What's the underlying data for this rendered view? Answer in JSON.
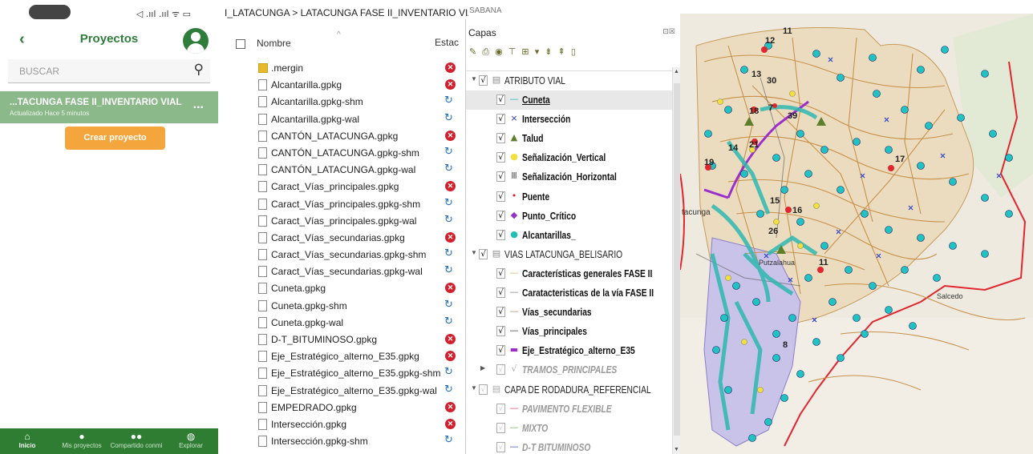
{
  "phone": {
    "status_icons": "◁ .ııl .ııl ᯤ ▭",
    "header": {
      "title": "Proyectos",
      "back_glyph": "‹"
    },
    "search": {
      "placeholder": "BUSCAR",
      "icon_glyph": "⚲"
    },
    "project": {
      "name": "...TACUNGA FASE II_INVENTARIO VIAL",
      "updated": "Actualizado Hace 5 minutos",
      "menu_glyph": "..."
    },
    "create_button": "Crear proyecto",
    "nav": [
      {
        "label": "Inicio",
        "icon": "home-icon",
        "glyph": "⌂"
      },
      {
        "label": "Mis proyectos",
        "icon": "person-icon",
        "glyph": "●"
      },
      {
        "label": "Compartido conmi",
        "icon": "people-icon",
        "glyph": "●●"
      },
      {
        "label": "Explorar",
        "icon": "globe-icon",
        "glyph": "◍"
      }
    ]
  },
  "files": {
    "breadcrumb": "I_LATACUNGA  >  LATACUNGA FASE II_INVENTARIO VIAL",
    "col_name": "Nombre",
    "col_status": "Estac",
    "items": [
      {
        "name": ".mergin",
        "type": "folder",
        "status": "error"
      },
      {
        "name": "Alcantarilla.gpkg",
        "type": "file",
        "status": "error"
      },
      {
        "name": "Alcantarilla.gpkg-shm",
        "type": "file",
        "status": "sync"
      },
      {
        "name": "Alcantarilla.gpkg-wal",
        "type": "file",
        "status": "sync"
      },
      {
        "name": "CANTÓN_LATACUNGA.gpkg",
        "type": "file",
        "status": "error"
      },
      {
        "name": "CANTÓN_LATACUNGA.gpkg-shm",
        "type": "file",
        "status": "sync"
      },
      {
        "name": "CANTÓN_LATACUNGA.gpkg-wal",
        "type": "file",
        "status": "sync"
      },
      {
        "name": "Caract_Vías_principales.gpkg",
        "type": "file",
        "status": "error"
      },
      {
        "name": "Caract_Vías_principales.gpkg-shm",
        "type": "file",
        "status": "sync"
      },
      {
        "name": "Caract_Vías_principales.gpkg-wal",
        "type": "file",
        "status": "sync"
      },
      {
        "name": "Caract_Vías_secundarias.gpkg",
        "type": "file",
        "status": "error"
      },
      {
        "name": "Caract_Vías_secundarias.gpkg-shm",
        "type": "file",
        "status": "sync"
      },
      {
        "name": "Caract_Vías_secundarias.gpkg-wal",
        "type": "file",
        "status": "sync"
      },
      {
        "name": "Cuneta.gpkg",
        "type": "file",
        "status": "error"
      },
      {
        "name": "Cuneta.gpkg-shm",
        "type": "file",
        "status": "sync"
      },
      {
        "name": "Cuneta.gpkg-wal",
        "type": "file",
        "status": "sync"
      },
      {
        "name": "D-T_BITUMINOSO.gpkg",
        "type": "file",
        "status": "error"
      },
      {
        "name": "Eje_Estratégico_alterno_E35.gpkg",
        "type": "file",
        "status": "error"
      },
      {
        "name": "Eje_Estratégico_alterno_E35.gpkg-shm",
        "type": "file",
        "status": "sync"
      },
      {
        "name": "Eje_Estratégico_alterno_E35.gpkg-wal",
        "type": "file",
        "status": "sync"
      },
      {
        "name": "EMPEDRADO.gpkg",
        "type": "file",
        "status": "error"
      },
      {
        "name": "Intersección.gpkg",
        "type": "file",
        "status": "error"
      },
      {
        "name": "Intersección.gpkg-shm",
        "type": "file",
        "status": "sync"
      }
    ],
    "status_glyphs": {
      "error": "✕",
      "sync": "↻"
    },
    "colors": {
      "error": "#d3202e",
      "sync": "#1e6fd0"
    }
  },
  "layers": {
    "title": "Capas",
    "panel_buttons": "⊡☒",
    "toolbar_glyphs": "✎ ⎙ ◉ ⊤ ⊞ ▾ ⇟ ⇞ ▯",
    "corner_text": "SABANA",
    "rows": [
      {
        "label": "ATRIBUTO VIAL",
        "level": 0,
        "kind": "group",
        "checked": true,
        "expanded": true,
        "symbol": "▤",
        "color": "#888"
      },
      {
        "label": "Cuneta",
        "level": 1,
        "kind": "layer",
        "checked": true,
        "symbol": "—",
        "color": "#1fbfb8",
        "selected": true,
        "underline": true
      },
      {
        "label": "Intersección",
        "level": 1,
        "kind": "layer",
        "checked": true,
        "symbol": "×",
        "color": "#2a3fc9"
      },
      {
        "label": "Talud",
        "level": 1,
        "kind": "layer",
        "checked": true,
        "symbol": "▲",
        "color": "#5b7f2a"
      },
      {
        "label": "Señalización_Vertical",
        "level": 1,
        "kind": "layer",
        "checked": true,
        "symbol": "●",
        "color": "#f1e13a"
      },
      {
        "label": "Señalización_Horizontal",
        "level": 1,
        "kind": "layer",
        "checked": true,
        "symbol": "Ⅲ",
        "color": "#555"
      },
      {
        "label": "Puente",
        "level": 1,
        "kind": "layer",
        "checked": true,
        "symbol": "•",
        "color": "#d3202e"
      },
      {
        "label": "Punto_Crítico",
        "level": 1,
        "kind": "layer",
        "checked": true,
        "symbol": "◆",
        "color": "#9b2fc9"
      },
      {
        "label": "Alcantarillas_",
        "level": 1,
        "kind": "layer",
        "checked": true,
        "symbol": "●",
        "color": "#1fbfb8"
      },
      {
        "label": "VIAS LATACUNGA_BELISARIO",
        "level": 0,
        "kind": "group",
        "checked": true,
        "expanded": true,
        "symbol": "▤",
        "color": "#888"
      },
      {
        "label": "Características generales FASE II",
        "level": 1,
        "kind": "layer",
        "checked": true,
        "symbol": "—",
        "color": "#d8b56a"
      },
      {
        "label": "Caratacteristicas de la vía FASE II",
        "level": 1,
        "kind": "layer",
        "checked": true,
        "symbol": "—",
        "color": "#888"
      },
      {
        "label": "Vías_secundarias",
        "level": 1,
        "kind": "layer",
        "checked": true,
        "symbol": "—",
        "color": "#c09060"
      },
      {
        "label": "Vías_principales",
        "level": 1,
        "kind": "layer",
        "checked": true,
        "symbol": "—",
        "color": "#444"
      },
      {
        "label": "Eje_Estratégico_alterno_E35",
        "level": 1,
        "kind": "layer",
        "checked": true,
        "symbol": "▬",
        "color": "#9b2fc9"
      },
      {
        "label": "TRAMOS_PRINCIPALES",
        "level": 1,
        "kind": "group-off",
        "checked": false,
        "expanded": false,
        "symbol": "√",
        "color": "#aaa"
      },
      {
        "label": "CAPA DE RODADURA_REFERENCIAL",
        "level": 0,
        "kind": "group",
        "checked": false,
        "expanded": true,
        "symbol": "▤",
        "color": "#aaa"
      },
      {
        "label": "PAVIMENTO FLEXIBLE",
        "level": 1,
        "kind": "dim",
        "checked": false,
        "symbol": "—",
        "color": "#e25a5a"
      },
      {
        "label": "MIXTO",
        "level": 1,
        "kind": "dim",
        "checked": false,
        "symbol": "—",
        "color": "#6fbf5a"
      },
      {
        "label": "D-T BITUMINOSO",
        "level": 1,
        "kind": "dim",
        "checked": false,
        "symbol": "—",
        "color": "#3a5fc9"
      }
    ]
  },
  "map": {
    "place_labels": [
      "tacunga",
      "Putzalahua",
      "Salcedo"
    ],
    "numbers": [
      "11",
      "12",
      "30",
      "13",
      "18",
      "7",
      "39",
      "14",
      "21",
      "19",
      "17",
      "15",
      "16",
      "26",
      "11",
      "8"
    ],
    "colors": {
      "terrain": "#efe8dc",
      "polygon": "#ecdcbf",
      "purple_poly": "#c8c2e8",
      "boundary": "#e0262e",
      "roads": "#c7914a",
      "culverts": "#23c2c2",
      "highlight": "#2fb8b0"
    }
  }
}
